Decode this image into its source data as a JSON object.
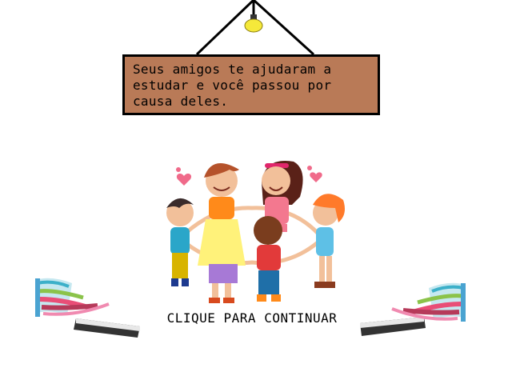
{
  "sign": {
    "lines": [
      "Seus amigos te ajudaram a",
      "estudar e você passou por",
      "causa deles."
    ]
  },
  "continue_label": "CLIQUE PARA CONTINUAR",
  "colors": {
    "sign_fill": "#b97a57",
    "lamp": "#f5e93a",
    "background": "#ffffff"
  },
  "icons": [
    "ceiling-lamp-icon",
    "children-holding-hands-illustration",
    "book-stack-icon"
  ]
}
